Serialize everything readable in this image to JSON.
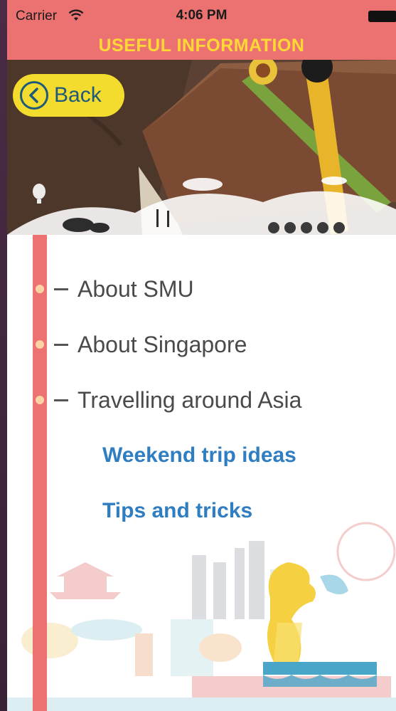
{
  "status_bar": {
    "carrier": "Carrier",
    "time": "4:06 PM"
  },
  "nav": {
    "title": "USEFUL INFORMATION",
    "back_label": "Back"
  },
  "menu": {
    "items": [
      {
        "label": "About SMU"
      },
      {
        "label": "About Singapore"
      },
      {
        "label": "Travelling around Asia"
      }
    ],
    "sub_items": [
      {
        "label": "Weekend trip ideas"
      },
      {
        "label": "Tips and tricks"
      }
    ]
  },
  "colors": {
    "header": "#ec7272",
    "title": "#ffd835",
    "back_button": "#f3dc2d",
    "link": "#2f7ec1"
  }
}
